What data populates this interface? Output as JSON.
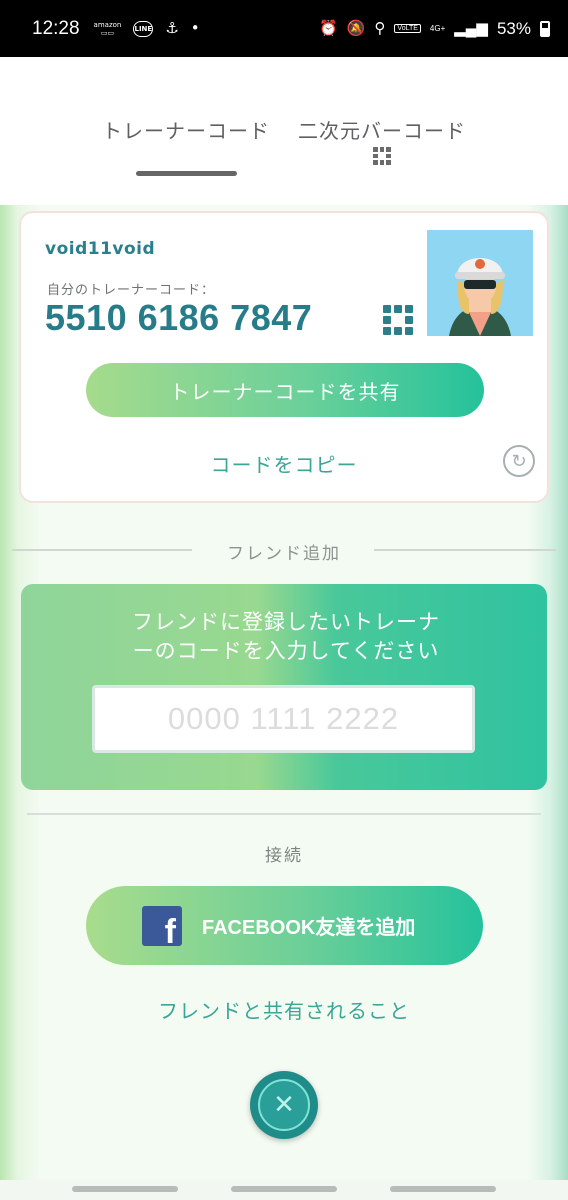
{
  "status_bar": {
    "time": "12:28",
    "amazon_label": "amazon",
    "line_label": "LINE",
    "volte_label": "VoLTE",
    "network_label": "4G+",
    "battery_percent": "53%"
  },
  "tabs": [
    {
      "label": "トレーナーコード",
      "active": true
    },
    {
      "label": "二次元バーコード",
      "active": false
    }
  ],
  "trainer_card": {
    "username": "void11void",
    "code_label": "自分のトレーナーコード：",
    "code_value": "5510 6186 7847",
    "share_button": "トレーナーコードを共有",
    "copy_link": "コードをコピー"
  },
  "add_friend": {
    "section_title": "フレンド追加",
    "prompt_line1": "フレンドに登録したいトレーナ",
    "prompt_line2": "ーのコードを入力してください",
    "input_placeholder": "0000 1111 2222",
    "input_value": ""
  },
  "connect": {
    "section_title": "接続",
    "facebook_button": "FACEBOOK友達を追加",
    "shared_link": "フレンドと共有されること"
  },
  "colors": {
    "accent_teal": "#277c89",
    "link_green": "#3ba596",
    "facebook_blue": "#3b5998",
    "close_button": "#1f8c8a"
  },
  "icons": [
    "qr-code-icon",
    "refresh-icon",
    "facebook-icon",
    "close-icon"
  ]
}
